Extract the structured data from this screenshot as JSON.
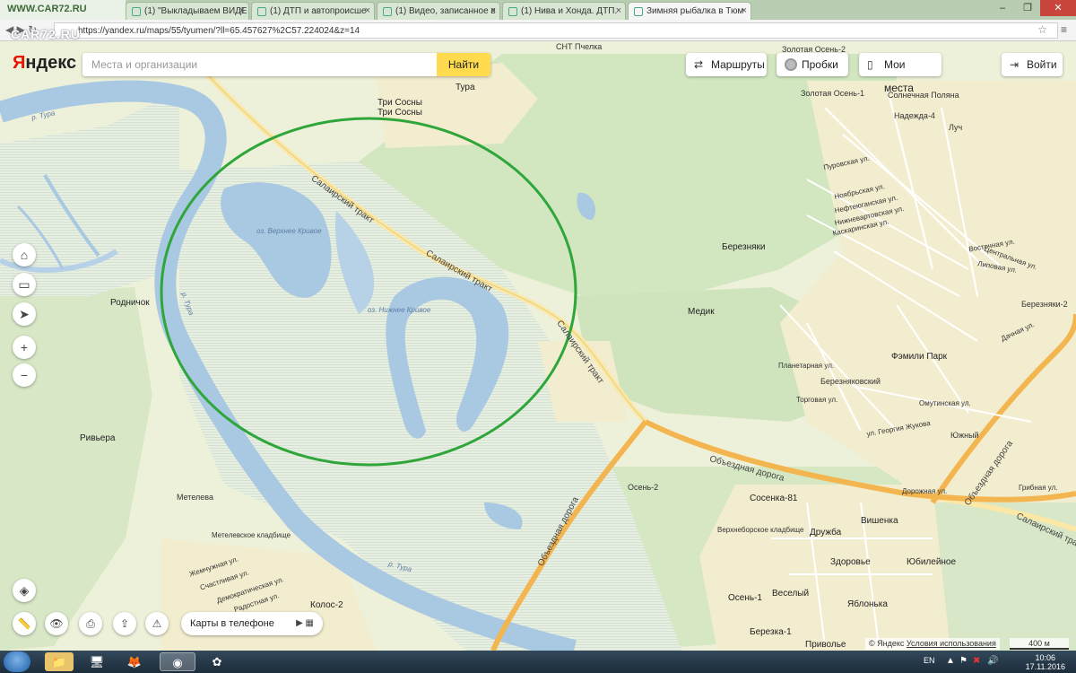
{
  "browser": {
    "corner_logo": "WWW.CAR72.RU",
    "tabs": [
      {
        "title": "(1) \"Выкладываем ВИДЕ",
        "active": false
      },
      {
        "title": "(1) ДТП и автопроисше",
        "active": false
      },
      {
        "title": "(1) Видео, записанное в",
        "active": false
      },
      {
        "title": "(1) Нива и Хонда. ДТП.",
        "active": false
      },
      {
        "title": "Зимняя рыбалка в Тюм",
        "active": true
      }
    ],
    "url": "https://yandex.ru/maps/55/tyumen/?ll=65.457627%2C57.224024&z=14",
    "watermark": "CAR72.RU"
  },
  "yandex": {
    "logo_first": "Я",
    "logo_rest": "ндекс",
    "search_placeholder": "Места и организации",
    "search_button": "Найти",
    "routes_label": "Маршруты",
    "traffic_label": "Пробки",
    "places_label": "Мои места",
    "login_label": "Войти",
    "phone_label": "Карты в телефоне",
    "copyright": "© Яндекс",
    "terms": "Условия использования",
    "scale": "400 м"
  },
  "map_labels": {
    "tri_sosny": "Три Сосны",
    "tri_sosny2": "Три Сосны",
    "tura": "Тура",
    "snt_pchelka": "СНТ Пчелка",
    "zolotaya_osen_2": "Золотая Осень-2",
    "zolotaya_osen_1": "Золотая Осень-1",
    "solnechnaya": "Солнечная Поляна",
    "nadezhda": "Надежда-4",
    "luch": "Луч",
    "bereznyaki": "Березняки",
    "bereznyaki2": "Березняки-2",
    "medik": "Медик",
    "family_park": "Фэмили Парк",
    "bereznyakovsky": "Березняковский",
    "yuzhny": "Южный",
    "rodnichok": "Родничок",
    "rivera": "Ривьера",
    "meteleva": "Метелева",
    "meteleva_cem": "Метелевское кладбище",
    "osen2": "Осень-2",
    "sosenka": "Сосенка-81",
    "vishenka": "Вишенка",
    "druzhba": "Дружба",
    "zdorovie": "Здоровье",
    "yubileynoe": "Юбилейное",
    "yablonka": "Яблонька",
    "osen1": "Осень-1",
    "vesely": "Веселый",
    "berezka": "Березка-1",
    "privolye": "Приволье",
    "kolos": "Колос-2",
    "verkhneborsk": "Верхнеборское кладбище",
    "lake_upper": "оз. Верхнее Кривое",
    "lake_lower": "оз. Нижнее Кривое",
    "river_tura1": "р. Тура",
    "river_tura2": "р. Тура",
    "river_tura3": "р. Тура",
    "salair1": "Салаирский тракт",
    "salair2": "Салаирский тракт",
    "salair3": "Салаирский тракт",
    "salair4": "Салаирский тракт",
    "obezd1": "Объездная дорога",
    "obezd2": "Объездная дорога",
    "obezd3": "Объездная дорога",
    "zhemch": "Жемчужная ул.",
    "schastl": "Счастливая ул.",
    "demokr": "Демократическая ул.",
    "radostn": "Радостная ул.",
    "dachnaya": "Дачная ул.",
    "vostochnaya": "Восточная ул.",
    "tsentralnaya": "Центральная ул.",
    "lipovaya": "Липовая ул.",
    "omutinskaya": "Омутинская ул.",
    "planetarnaya": "Планетарная ул.",
    "torgovaya": "Торговая ул.",
    "dorozhnaya": "Дорожная ул.",
    "gribnaya": "Грибная ул.",
    "kaskarinskaya": "Каскаринская ул.",
    "noyabrskaya": "Ноябрьская ул.",
    "neftyugansk": "Нефтеюганская ул.",
    "nizhnevart": "Нижневартовская ул.",
    "purovskaya": "Пуровская ул.",
    "ul_zhukova": "ул. Георгия Жукова"
  },
  "taskbar": {
    "lang": "EN",
    "time": "10:06",
    "date": "17.11.2016"
  }
}
